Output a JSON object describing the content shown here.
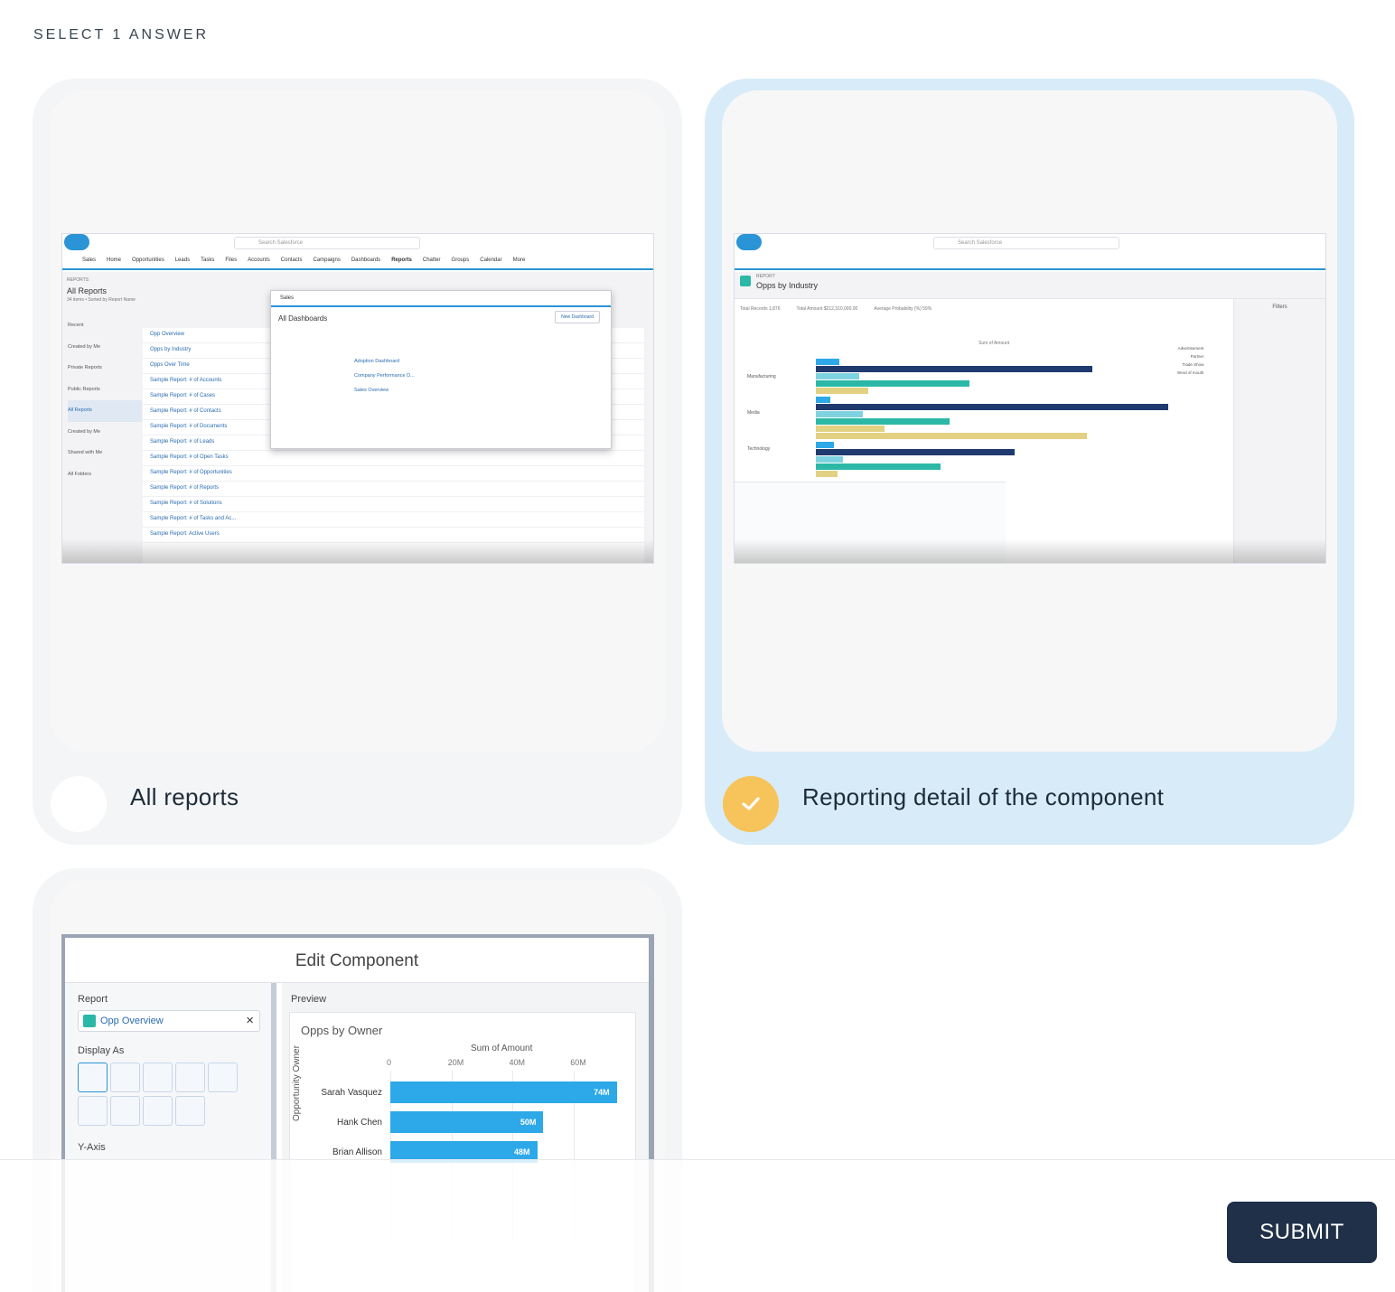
{
  "instruction": "SELECT 1 ANSWER",
  "options": [
    {
      "label": "All reports",
      "selected": false,
      "screenshot": {
        "search": "Search Salesforce",
        "nav": [
          "Sales",
          "Home",
          "Opportunities",
          "Leads",
          "Tasks",
          "Files",
          "Accounts",
          "Contacts",
          "Campaigns",
          "Dashboards",
          "Reports",
          "Chatter",
          "Groups",
          "Calendar",
          "More"
        ],
        "section": "REPORTS",
        "title": "All Reports",
        "subtitle": "34 items • Sorted by Report Name",
        "sidebar": [
          "Recent",
          "Created by Me",
          "Private Reports",
          "Public Reports",
          "All Reports",
          "Created by Me",
          "Shared with Me",
          "All Folders"
        ],
        "rows": [
          "Opp Overview",
          "Opps by Industry",
          "Opps Over Time",
          "Sample Report: # of Accounts",
          "Sample Report: # of Cases",
          "Sample Report: # of Contacts",
          "Sample Report: # of Documents",
          "Sample Report: # of Leads",
          "Sample Report: # of Open Tasks",
          "Sample Report: # of Opportunities",
          "Sample Report: # of Reports",
          "Sample Report: # of Solutions",
          "Sample Report: # of Tasks and Ac...",
          "Sample Report: Active Users"
        ],
        "overlay_title": "All Dashboards",
        "overlay_rows": [
          "Adoption Dashboard",
          "Company Performance D...",
          "Sales Overview"
        ],
        "overlay_button": "New Dashboard"
      }
    },
    {
      "label": "Reporting detail of the component",
      "selected": true,
      "screenshot": {
        "search": "Search Salesforce",
        "report_label": "REPORT",
        "title": "Opps by Industry",
        "stats": [
          "Total Records 1,876",
          "Total Amount $212,310,000.00",
          "Average Probability (%) 59%"
        ],
        "chart_title": "Sum of Amount",
        "groups": [
          "Manufacturing",
          "Media",
          "Technology"
        ],
        "legend": [
          "Advertisement",
          "Partner",
          "Trade Show",
          "Word of mouth"
        ],
        "filters_title": "Filters"
      }
    },
    {
      "label": "",
      "selected": false,
      "screenshot": {
        "title": "Edit Component",
        "report_label": "Report",
        "report_value": "Opp Overview",
        "display_as": "Display As",
        "y_axis": "Y-Axis",
        "preview_label": "Preview",
        "chart_title": "Opps by Owner",
        "axis_label": "Sum of Amount",
        "ticks": [
          "0",
          "20M",
          "40M",
          "60M"
        ],
        "y_label": "Opportunity Owner"
      }
    }
  ],
  "chart_data": {
    "type": "bar",
    "title": "Opps by Owner",
    "xlabel": "Sum of Amount",
    "ylabel": "Opportunity Owner",
    "categories": [
      "Sarah Vasquez",
      "Hank Chen",
      "Brian Allison"
    ],
    "values": [
      74,
      50,
      48
    ],
    "value_labels": [
      "74M",
      "50M",
      "48M"
    ],
    "xlim": [
      0,
      75
    ]
  },
  "submit_label": "SUBMIT",
  "colors": {
    "selected_card": "#d8ebf8",
    "check": "#f7c35b",
    "submit": "#1f3048",
    "bar": "#2da8e8"
  }
}
